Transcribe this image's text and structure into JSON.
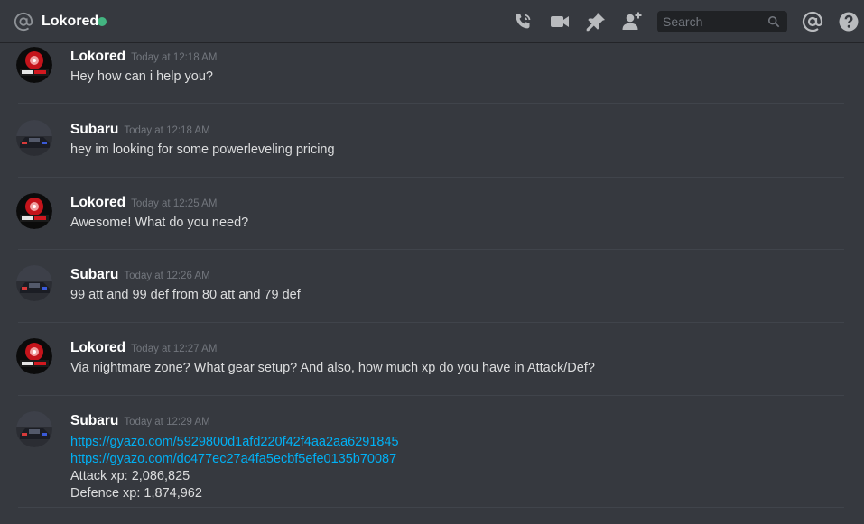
{
  "header": {
    "channel_name": "Lokored",
    "status_color": "#43b581",
    "icons": [
      "at-icon",
      "call-icon",
      "video-icon",
      "pin-icon",
      "add-friend-icon",
      "mention-icon",
      "help-icon"
    ],
    "search_placeholder": "Search"
  },
  "messages": [
    {
      "author": "Lokored",
      "time": "Today at 12:18 AM",
      "lines": [
        "Hey how can i help you?"
      ]
    },
    {
      "author": "Subaru",
      "time": "Today at 12:18 AM",
      "lines": [
        "hey im looking for some powerleveling pricing"
      ]
    },
    {
      "author": "Lokored",
      "time": "Today at 12:25 AM",
      "lines": [
        "Awesome! What do you need?"
      ]
    },
    {
      "author": "Subaru",
      "time": "Today at 12:26 AM",
      "lines": [
        "99 att and 99 def from 80 att and 79 def"
      ]
    },
    {
      "author": "Lokored",
      "time": "Today at 12:27 AM",
      "lines": [
        "Via nightmare zone? What gear setup? And also, how much xp do you have in Attack/Def?"
      ]
    },
    {
      "author": "Subaru",
      "time": "Today at 12:29 AM",
      "links": [
        "https://gyazo.com/5929800d1afd220f42f4aa2aa6291845",
        "https://gyazo.com/dc477ec27a4fa5ecbf5efe0135b70087"
      ],
      "lines": [
        "Attack xp: 2,086,825",
        "Defence xp: 1,874,962"
      ]
    }
  ],
  "colors": {
    "background": "#36393f",
    "link": "#00b0f4",
    "muted": "#72767d"
  }
}
